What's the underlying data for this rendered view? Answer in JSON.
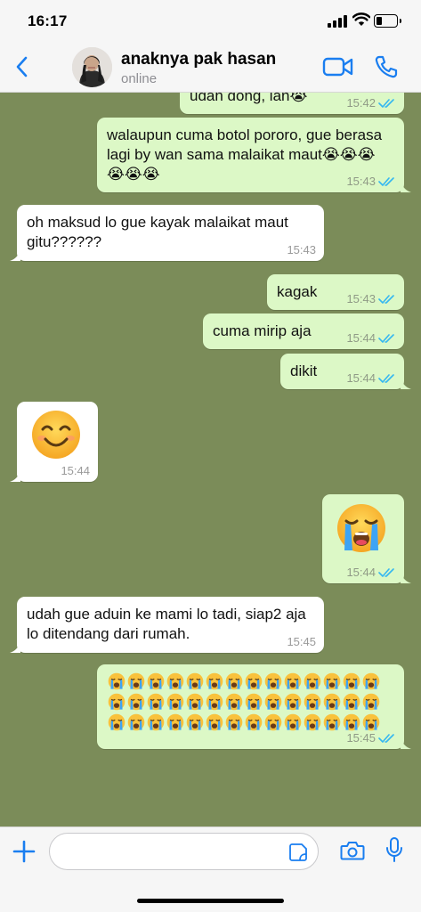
{
  "status_bar": {
    "time": "16:17"
  },
  "header": {
    "contact_name": "anaknya pak hasan",
    "contact_status": "online"
  },
  "messages": [
    {
      "direction": "out",
      "text": "udah dong, lan😭",
      "time": "15:42",
      "read": true
    },
    {
      "direction": "out",
      "text": "walaupun cuma botol pororo, gue berasa lagi by wan sama malaikat maut😭😭😭😭😭😭",
      "time": "15:43",
      "read": true
    },
    {
      "direction": "in",
      "text": "oh maksud lo gue kayak malaikat maut gitu??????",
      "time": "15:43"
    },
    {
      "direction": "out",
      "text": "kagak",
      "time": "15:43",
      "read": true
    },
    {
      "direction": "out",
      "text": "cuma mirip aja",
      "time": "15:44",
      "read": true
    },
    {
      "direction": "out",
      "text": "dikit",
      "time": "15:44",
      "read": true
    },
    {
      "direction": "in",
      "emoji": "smiling-face",
      "time": "15:44"
    },
    {
      "direction": "out",
      "emoji": "loudly-crying-face",
      "time": "15:44",
      "read": true
    },
    {
      "direction": "in",
      "text": "udah gue aduin ke mami lo tadi, siap2 aja lo ditendang dari rumah.",
      "time": "15:45"
    },
    {
      "direction": "out",
      "text": "😭😭😭😭😭😭😭😭😭😭😭😭😭😭😭😭😭😭😭😭😭😭😭😭😭😭😭😭😭😭😭😭😭😭😭😭😭😭😭😭😭😭",
      "crying_emoji_count": 42,
      "time": "15:45",
      "read": true
    }
  ],
  "composer": {
    "placeholder": ""
  },
  "colors": {
    "accent": "#1a7ef0",
    "outgoing_bubble": "#dcf8c6",
    "incoming_bubble": "#ffffff",
    "chat_background": "#7b8c59",
    "read_ticks": "#34b7f1"
  },
  "icons": {
    "back": "chevron-left-icon",
    "video": "video-camera-icon",
    "call": "phone-icon",
    "attach": "plus-icon",
    "sticker": "sticker-icon",
    "camera": "camera-icon",
    "mic": "microphone-icon"
  }
}
